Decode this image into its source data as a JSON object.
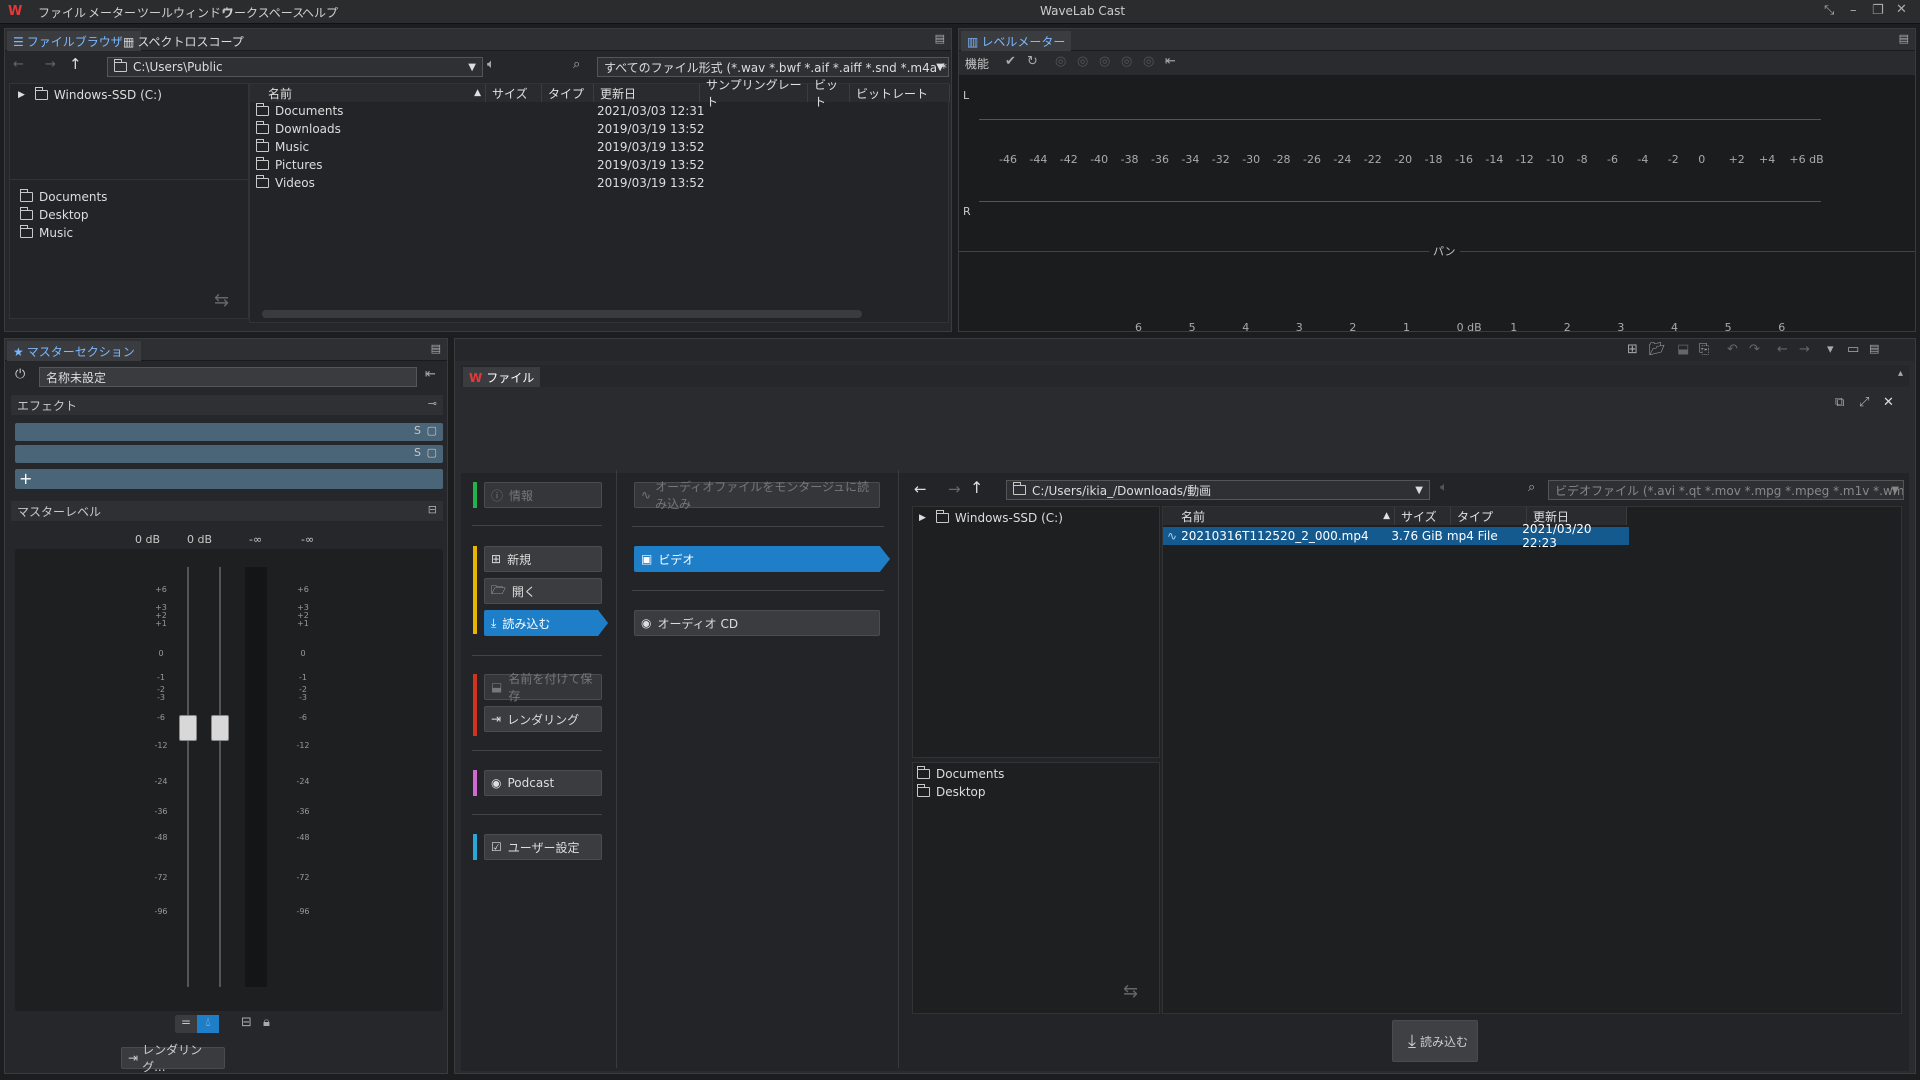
{
  "app": {
    "title": "WaveLab Cast"
  },
  "menu": [
    "ファイル",
    "メーター",
    "ツールウィンドウ",
    "ワークスペース",
    "ヘルプ"
  ],
  "file_browser": {
    "tabs": [
      "ファイルブラウザー",
      "スペクトロスコープ"
    ],
    "path": "C:\\Users\\Public",
    "filter": "すべてのファイル形式 (*.wav *.bwf *.aif *.aiff *.snd *.m4a *.m4p *",
    "tree_root": "Windows-SSD (C:)",
    "favorites": [
      "Documents",
      "Desktop",
      "Music"
    ],
    "columns": [
      "名前",
      "サイズ",
      "タイプ",
      "更新日",
      "サンプリングレート",
      "ビット",
      "ビットレート"
    ],
    "rows": [
      {
        "name": "Documents",
        "date": "2021/03/03 12:31"
      },
      {
        "name": "Downloads",
        "date": "2019/03/19 13:52"
      },
      {
        "name": "Music",
        "date": "2019/03/19 13:52"
      },
      {
        "name": "Pictures",
        "date": "2019/03/19 13:52"
      },
      {
        "name": "Videos",
        "date": "2019/03/19 13:52"
      }
    ]
  },
  "level_meter": {
    "tab": "レベルメーター",
    "func_label": "機能",
    "ch_l": "L",
    "ch_r": "R",
    "scale": [
      "-46",
      "-44",
      "-42",
      "-40",
      "-38",
      "-36",
      "-34",
      "-32",
      "-30",
      "-28",
      "-26",
      "-24",
      "-22",
      "-20",
      "-18",
      "-16",
      "-14",
      "-12",
      "-10",
      "-8",
      "-6",
      "-4",
      "-2",
      "0",
      "+2",
      "+4",
      "+6 dB"
    ],
    "pan_label": "パン",
    "pan_scale": [
      "6",
      "5",
      "4",
      "3",
      "2",
      "1",
      "0 dB",
      "1",
      "2",
      "3",
      "4",
      "5",
      "6"
    ]
  },
  "master": {
    "tab": "マスターセクション",
    "preset": "名称未設定",
    "effects_label": "エフェクト",
    "master_level_label": "マスターレベル",
    "gain_values": [
      "0 dB",
      "0 dB",
      "-∞",
      "-∞"
    ],
    "scale": [
      "+6",
      "+3",
      "+2",
      "+1",
      "0",
      "-1",
      "-2",
      "-3",
      "-6",
      "-12",
      "-24",
      "-36",
      "-48",
      "-72",
      "-96"
    ],
    "render_button": "レンダリング..."
  },
  "file_panel": {
    "tab": "ファイル",
    "menu": {
      "info": "情報",
      "new": "新規",
      "open": "開く",
      "import": "読み込む",
      "save_as": "名前を付けて保存",
      "render": "レンダリング",
      "podcast": "Podcast",
      "user_settings": "ユーザー設定"
    },
    "sub": {
      "load_to_montage": "オーディオファイルをモンタージュに読み込み",
      "video": "ビデオ",
      "audio_cd": "オーディオ CD"
    },
    "path": "C:/Users/ikia_/Downloads/動画",
    "filter": "ビデオファイル (*.avi *.qt *.mov *.mpg *.mpeg *.m1v *.wmv *.vol",
    "tree_root": "Windows-SSD (C:)",
    "favorites": [
      "Documents",
      "Desktop"
    ],
    "columns": [
      "名前",
      "サイズ",
      "タイプ",
      "更新日"
    ],
    "file": {
      "name": "20210316T112520_2_000.mp4",
      "size": "3.76 GiB",
      "type": "mp4 File",
      "date": "2021/03/20 22:23"
    },
    "import_button": "読み込む"
  },
  "colors": {
    "accent": "#1e7fc8",
    "green": "#22b14c",
    "yellow": "#e8b400",
    "red": "#d0341c",
    "pink": "#d06ad0",
    "cyan": "#2aa6d8"
  }
}
